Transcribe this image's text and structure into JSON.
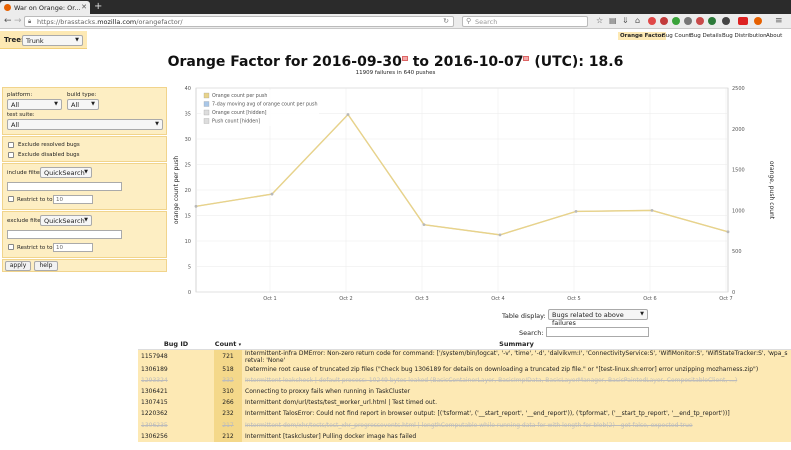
{
  "browser": {
    "tab_title": "War on Orange: Or...",
    "url_prefix": "https://brasstacks.",
    "url_domain": "mozilla.com",
    "url_suffix": "/orangefactor/",
    "search_placeholder": "Search"
  },
  "tree": {
    "label": "Tree:",
    "value": "Trunk"
  },
  "topnav": [
    "Orange Factor",
    "Bug Count",
    "Bug Details",
    "Bug Distribution",
    "About"
  ],
  "header": {
    "title_prefix": "Orange Factor for 2016-09-30",
    "title_mid": " to 2016-10-07",
    "title_suffix": " (UTC): 18.6",
    "subtitle": "11909 failures in 640 pushes"
  },
  "filters": {
    "platform_label": "platform:",
    "platform_value": "All",
    "build_type_label": "build type:",
    "build_type_value": "All",
    "test_suite_label": "test suite:",
    "test_suite_value": "All",
    "exclude_resolved": "Exclude resolved bugs",
    "exclude_disabled": "Exclude disabled bugs",
    "include_filter_label": "include filter:",
    "include_filter_value": "QuickSearch",
    "restrict_label": "Restrict to top",
    "restrict_value": "10",
    "exclude_filter_label": "exclude filter:",
    "exclude_filter_value": "QuickSearch",
    "restrict2_label": "Restrict to top",
    "restrict2_value": "10",
    "apply": "apply",
    "help": "help"
  },
  "chart_data": {
    "type": "line",
    "title": "",
    "xlabel": "",
    "ylabel": "orange count per push",
    "y2label": "orange, push count",
    "categories": [
      "2016-09-30",
      "2016-10-01",
      "2016-10-02",
      "2016-10-03",
      "2016-10-04",
      "2016-10-05",
      "2016-10-06",
      "2016-10-07"
    ],
    "xticks": [
      "Oct 1",
      "Oct 2",
      "Oct 3",
      "Oct 4",
      "Oct 5",
      "Oct 6",
      "Oct 7"
    ],
    "ylim": [
      0,
      40
    ],
    "yticks": [
      0,
      5,
      10,
      15,
      20,
      25,
      30,
      35,
      40
    ],
    "y2lim": [
      0,
      2500
    ],
    "y2ticks": [
      0,
      500,
      1000,
      1500,
      2000,
      2500
    ],
    "grid": true,
    "legend_position": "top-left",
    "legend": [
      "Orange count per push",
      "7-day moving avg of orange count per push",
      "Orange count [hidden]",
      "Push count [hidden]"
    ],
    "legend_colors": [
      "#e8d38a",
      "#a9c7e8",
      "#dddddd",
      "#dddddd"
    ],
    "series": [
      {
        "name": "Orange count per push",
        "values": [
          16.8,
          19.2,
          34.8,
          13.2,
          11.2,
          15.8,
          16.0,
          11.8
        ]
      },
      {
        "name": "7-day moving avg of orange count per push",
        "values": [
          16.8,
          19.2,
          34.8,
          13.2,
          11.2,
          15.8,
          16.0,
          11.8
        ]
      }
    ],
    "colors": {
      "line": "#e8d38a",
      "avg": "#e2d2a0",
      "point": "#b8b8b8"
    }
  },
  "table_controls": {
    "display_label": "Table display:",
    "display_value": "Bugs related to above failures",
    "search_label": "Search:"
  },
  "bugs": {
    "headers": [
      "Bug ID",
      "Count",
      "Summary"
    ],
    "count_sort_icon": "▾",
    "rows": [
      {
        "id": "1157948",
        "count": "721",
        "summary": "Intermittent-infra DMError: Non-zero return code for command: ['/system/bin/logcat', '-v', 'time', '-d', 'dalvikvm:I', 'ConnectivityService:S', 'WifiMonitor:S', 'WifiStateTracker:S', 'wpa_su",
        "summary2": "retval: 'None'",
        "resolved": false
      },
      {
        "id": "1306189",
        "count": "518",
        "summary": "Determine root cause of truncated zip files (\"Check bug 1306189 for details on downloading a truncated zip file.\" or \"[test-linux.sh:error] error unzipping mozharness.zip\")",
        "resolved": false
      },
      {
        "id": "1293324",
        "count": "332",
        "summary": "Intermittent leakcheck | default process: 10249 bytes leaked (BasicContainerLayer, BasicImpIData, BasicLayerManager, BasicPaintedLayer, CompositableClient, ...)",
        "resolved": true
      },
      {
        "id": "1306421",
        "count": "310",
        "summary": "Connecting to proxxy fails when running in TaskCluster",
        "resolved": false
      },
      {
        "id": "1307415",
        "count": "266",
        "summary": "Intermittent dom/url/tests/test_worker_url.html | Test timed out.",
        "resolved": false
      },
      {
        "id": "1220362",
        "count": "232",
        "summary": "Intermittent TalosError: Could not find report in browser output: [('tsformat', ('__start_report', '__end_report')), ('tpformat', ('__start_tp_report', '__end_tp_report'))]",
        "resolved": false
      },
      {
        "id": "1306235",
        "count": "217",
        "summary": "Intermittent dom/xhr/tests/test_xhr_progressevents.html | lengthComputable while running data for with length for blob(2) - got false, expected true",
        "resolved": true
      },
      {
        "id": "1306256",
        "count": "212",
        "summary": "Intermittent [taskcluster] Pulling docker image has failed",
        "resolved": false
      }
    ]
  }
}
